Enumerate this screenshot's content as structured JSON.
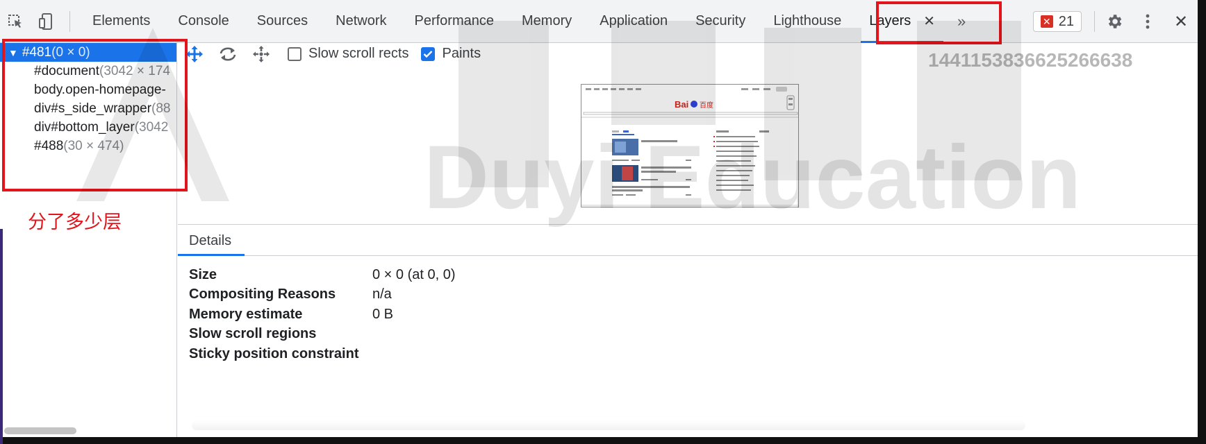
{
  "tabs": [
    {
      "label": "Elements",
      "active": false
    },
    {
      "label": "Console",
      "active": false
    },
    {
      "label": "Sources",
      "active": false
    },
    {
      "label": "Network",
      "active": false
    },
    {
      "label": "Performance",
      "active": false
    },
    {
      "label": "Memory",
      "active": false
    },
    {
      "label": "Application",
      "active": false
    },
    {
      "label": "Security",
      "active": false
    },
    {
      "label": "Lighthouse",
      "active": false
    },
    {
      "label": "Layers",
      "active": true
    }
  ],
  "tabbar": {
    "close_glyph": "✕",
    "more_glyph": "»",
    "error_count": "21",
    "error_glyph": "✕",
    "close_devtools_glyph": "✕"
  },
  "icons": {
    "inspect": "inspect-element-icon",
    "device": "device-toolbar-icon",
    "pan": "pan-mode-icon",
    "rotate": "rotate-mode-icon",
    "reset": "reset-view-icon",
    "settings": "gear-icon",
    "more": "kebab-menu-icon"
  },
  "tree": {
    "selected": {
      "name": "#481",
      "dims": "(0 × 0)",
      "toggle": "▼"
    },
    "children": [
      {
        "name": "#document",
        "dims": "(3042 × 174"
      },
      {
        "name": "body.open-homepage-",
        "dims": ""
      },
      {
        "name": "div#s_side_wrapper",
        "dims": "(88"
      },
      {
        "name": "div#bottom_layer",
        "dims": "(3042"
      },
      {
        "name": "#488",
        "dims": "(30 × 474)"
      }
    ],
    "annotation": "分了多少层"
  },
  "toolbar": {
    "slow_scroll_label": "Slow scroll rects",
    "slow_scroll_checked": false,
    "paints_label": "Paints",
    "paints_checked": true
  },
  "thumbnail": {
    "logo_left": "Bai",
    "logo_right": "百度"
  },
  "details": {
    "tab": "Details",
    "rows": [
      {
        "label": "Size",
        "value": "0 × 0 (at 0, 0)"
      },
      {
        "label": "Compositing Reasons",
        "value": "n/a"
      },
      {
        "label": "Memory estimate",
        "value": "0 B"
      },
      {
        "label": "Slow scroll regions",
        "value": ""
      },
      {
        "label": "Sticky position constraint",
        "value": ""
      }
    ]
  },
  "watermark": {
    "text": "Duyi Education",
    "number": "1441153836625266638"
  },
  "colors": {
    "accent": "#1a73e8",
    "annotation_red": "#e3141b",
    "error_red": "#d93025"
  }
}
